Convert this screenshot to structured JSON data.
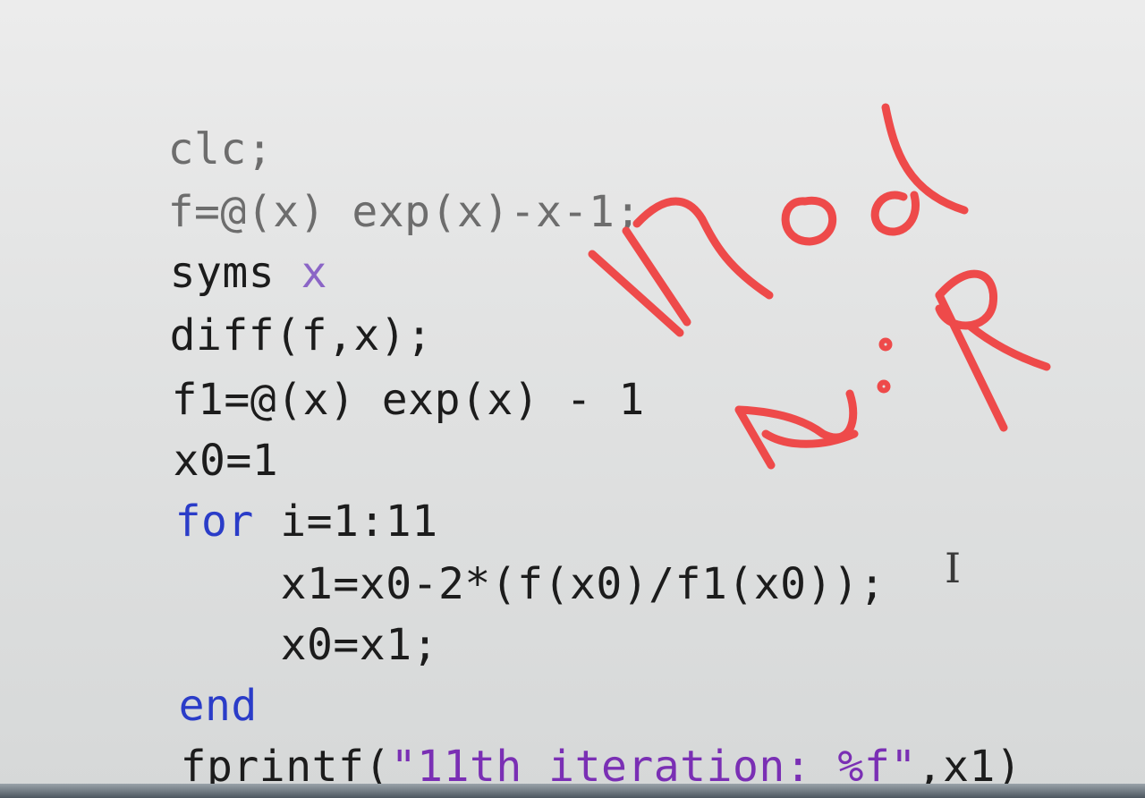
{
  "editor": {
    "lines": [
      {
        "text": "clc;"
      },
      {
        "t1": "f=@(x) exp(x)-x-1;"
      },
      {
        "t1": "syms ",
        "t2": "x"
      },
      {
        "text": "diff(f,x);"
      },
      {
        "text": "f1=@(x) exp(x) - 1"
      },
      {
        "text": "x0=1"
      },
      {
        "kw": "for",
        "rest": " i=1:11"
      },
      {
        "text": "x1=x0-2*(f(x0)/f1(x0));"
      },
      {
        "text": "x0=x1;"
      },
      {
        "kw": "end"
      },
      {
        "fn": "fprintf(",
        "str": "\"11th iteration: %f\"",
        "rest": ",x1)"
      }
    ]
  },
  "annotation": {
    "handwriting": [
      "Mod",
      "N:R"
    ],
    "color": "#ee4a4a"
  },
  "colors": {
    "keyword": "#2a3cc8",
    "string": "#7a2fb4",
    "text": "#1c1c1c"
  }
}
